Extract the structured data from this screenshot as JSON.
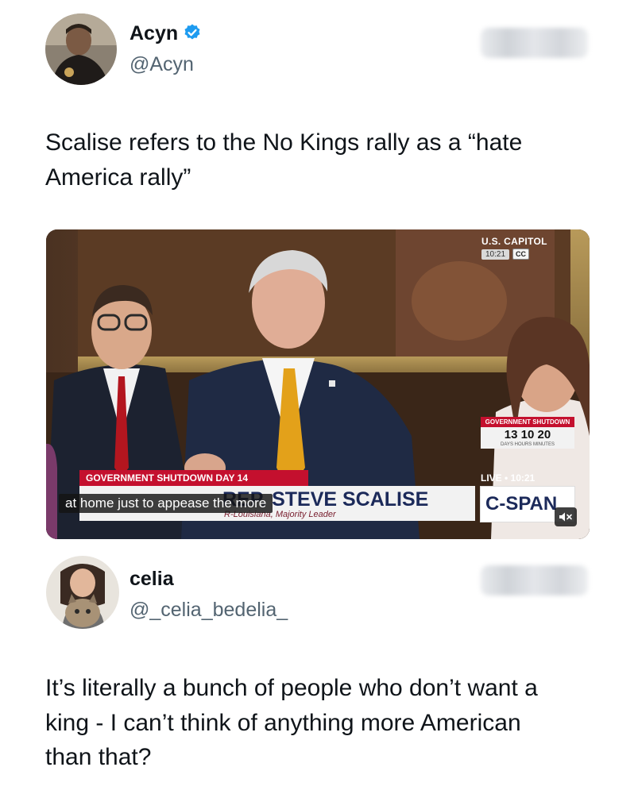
{
  "tweet1": {
    "name": "Acyn",
    "handle": "@Acyn",
    "text": "Scalise refers to the No Kings rally as a “hate America rally”"
  },
  "media": {
    "capitol_label": "U.S. CAPITOL",
    "capitol_time": "10:21",
    "cc": "CC",
    "banner_top": "GOVERNMENT SHUTDOWN DAY 14",
    "caption": "at home just to appease the more",
    "lower_third_name": "REP. STEVE SCALISE",
    "lower_third_sub": "R-Louisiana, Majority Leader",
    "shutdown_label": "GOVERNMENT SHUTDOWN",
    "timer_values": "13 10 20",
    "timer_units": "DAYS HOURS MINUTES",
    "live_label": "LIVE • 10:21",
    "network": "C-SPAN"
  },
  "tweet2": {
    "name": "celia",
    "handle": "@_celia_bedelia_",
    "text": "It’s literally a bunch of people who don’t want a king - I can’t think of anything more American than that?"
  },
  "colors": {
    "verified": "#1d9bf0",
    "handle_gray": "#536471",
    "cspan_red": "#c4102e",
    "tie_gold": "#e3a11a",
    "tie_red": "#b3161f"
  }
}
